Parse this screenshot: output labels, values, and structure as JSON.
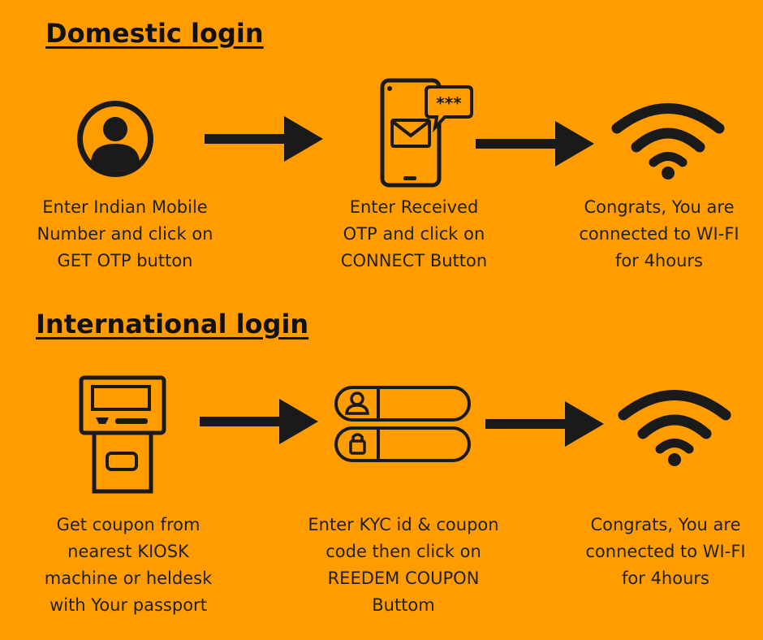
{
  "domestic": {
    "heading": "Domestic login",
    "steps": [
      {
        "icon": "user-icon",
        "text": "Enter Indian Mobile\nNumber and click on\nGET OTP button"
      },
      {
        "icon": "phone-otp-icon",
        "text": "Enter Received\nOTP and click on\nCONNECT Button"
      },
      {
        "icon": "wifi-icon",
        "text": "Congrats, You are\nconnected to WI-FI\nfor 4hours"
      }
    ]
  },
  "international": {
    "heading": "International login",
    "steps": [
      {
        "icon": "kiosk-icon",
        "text": "Get coupon from\nnearest KIOSK\nmachine or heldesk\nwith Your passport"
      },
      {
        "icon": "login-form-icon",
        "text": "Enter KYC id & coupon\ncode then click on\nREEDEM COUPON\nButtom"
      },
      {
        "icon": "wifi-icon",
        "text": "Congrats, You are\nconnected to WI-FI\nfor 4hours"
      }
    ]
  },
  "colors": {
    "background": "#FF9D00",
    "ink": "#1a1a1a"
  }
}
